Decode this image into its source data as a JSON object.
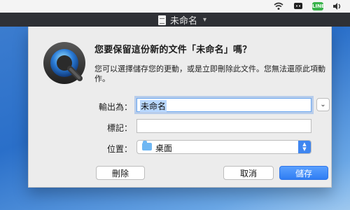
{
  "menubar": {
    "tray": [
      {
        "icon": "wifi-icon"
      },
      {
        "icon": "messaging-icon"
      },
      {
        "icon": "line-icon",
        "label": "LINE"
      },
      {
        "icon": "speaker-icon"
      }
    ]
  },
  "window": {
    "title": "未命名"
  },
  "dialog": {
    "question": "您要保留這份新的文件「未命名」嗎？",
    "explanation": "您可以選擇儲存您的更動，或是立即刪除此文件。您無法還原此項動作。",
    "fields": {
      "export_as_label": "輸出為：",
      "export_as_value": "未命名",
      "tags_label": "標記：",
      "tags_value": "",
      "location_label": "位置：",
      "location_value": "桌面"
    },
    "buttons": {
      "delete": "刪除",
      "cancel": "取消",
      "save": "儲存"
    }
  },
  "colors": {
    "accent": "#3f86f0",
    "focus_ring": "#6aa6ee",
    "dialog_bg": "#ececec"
  }
}
